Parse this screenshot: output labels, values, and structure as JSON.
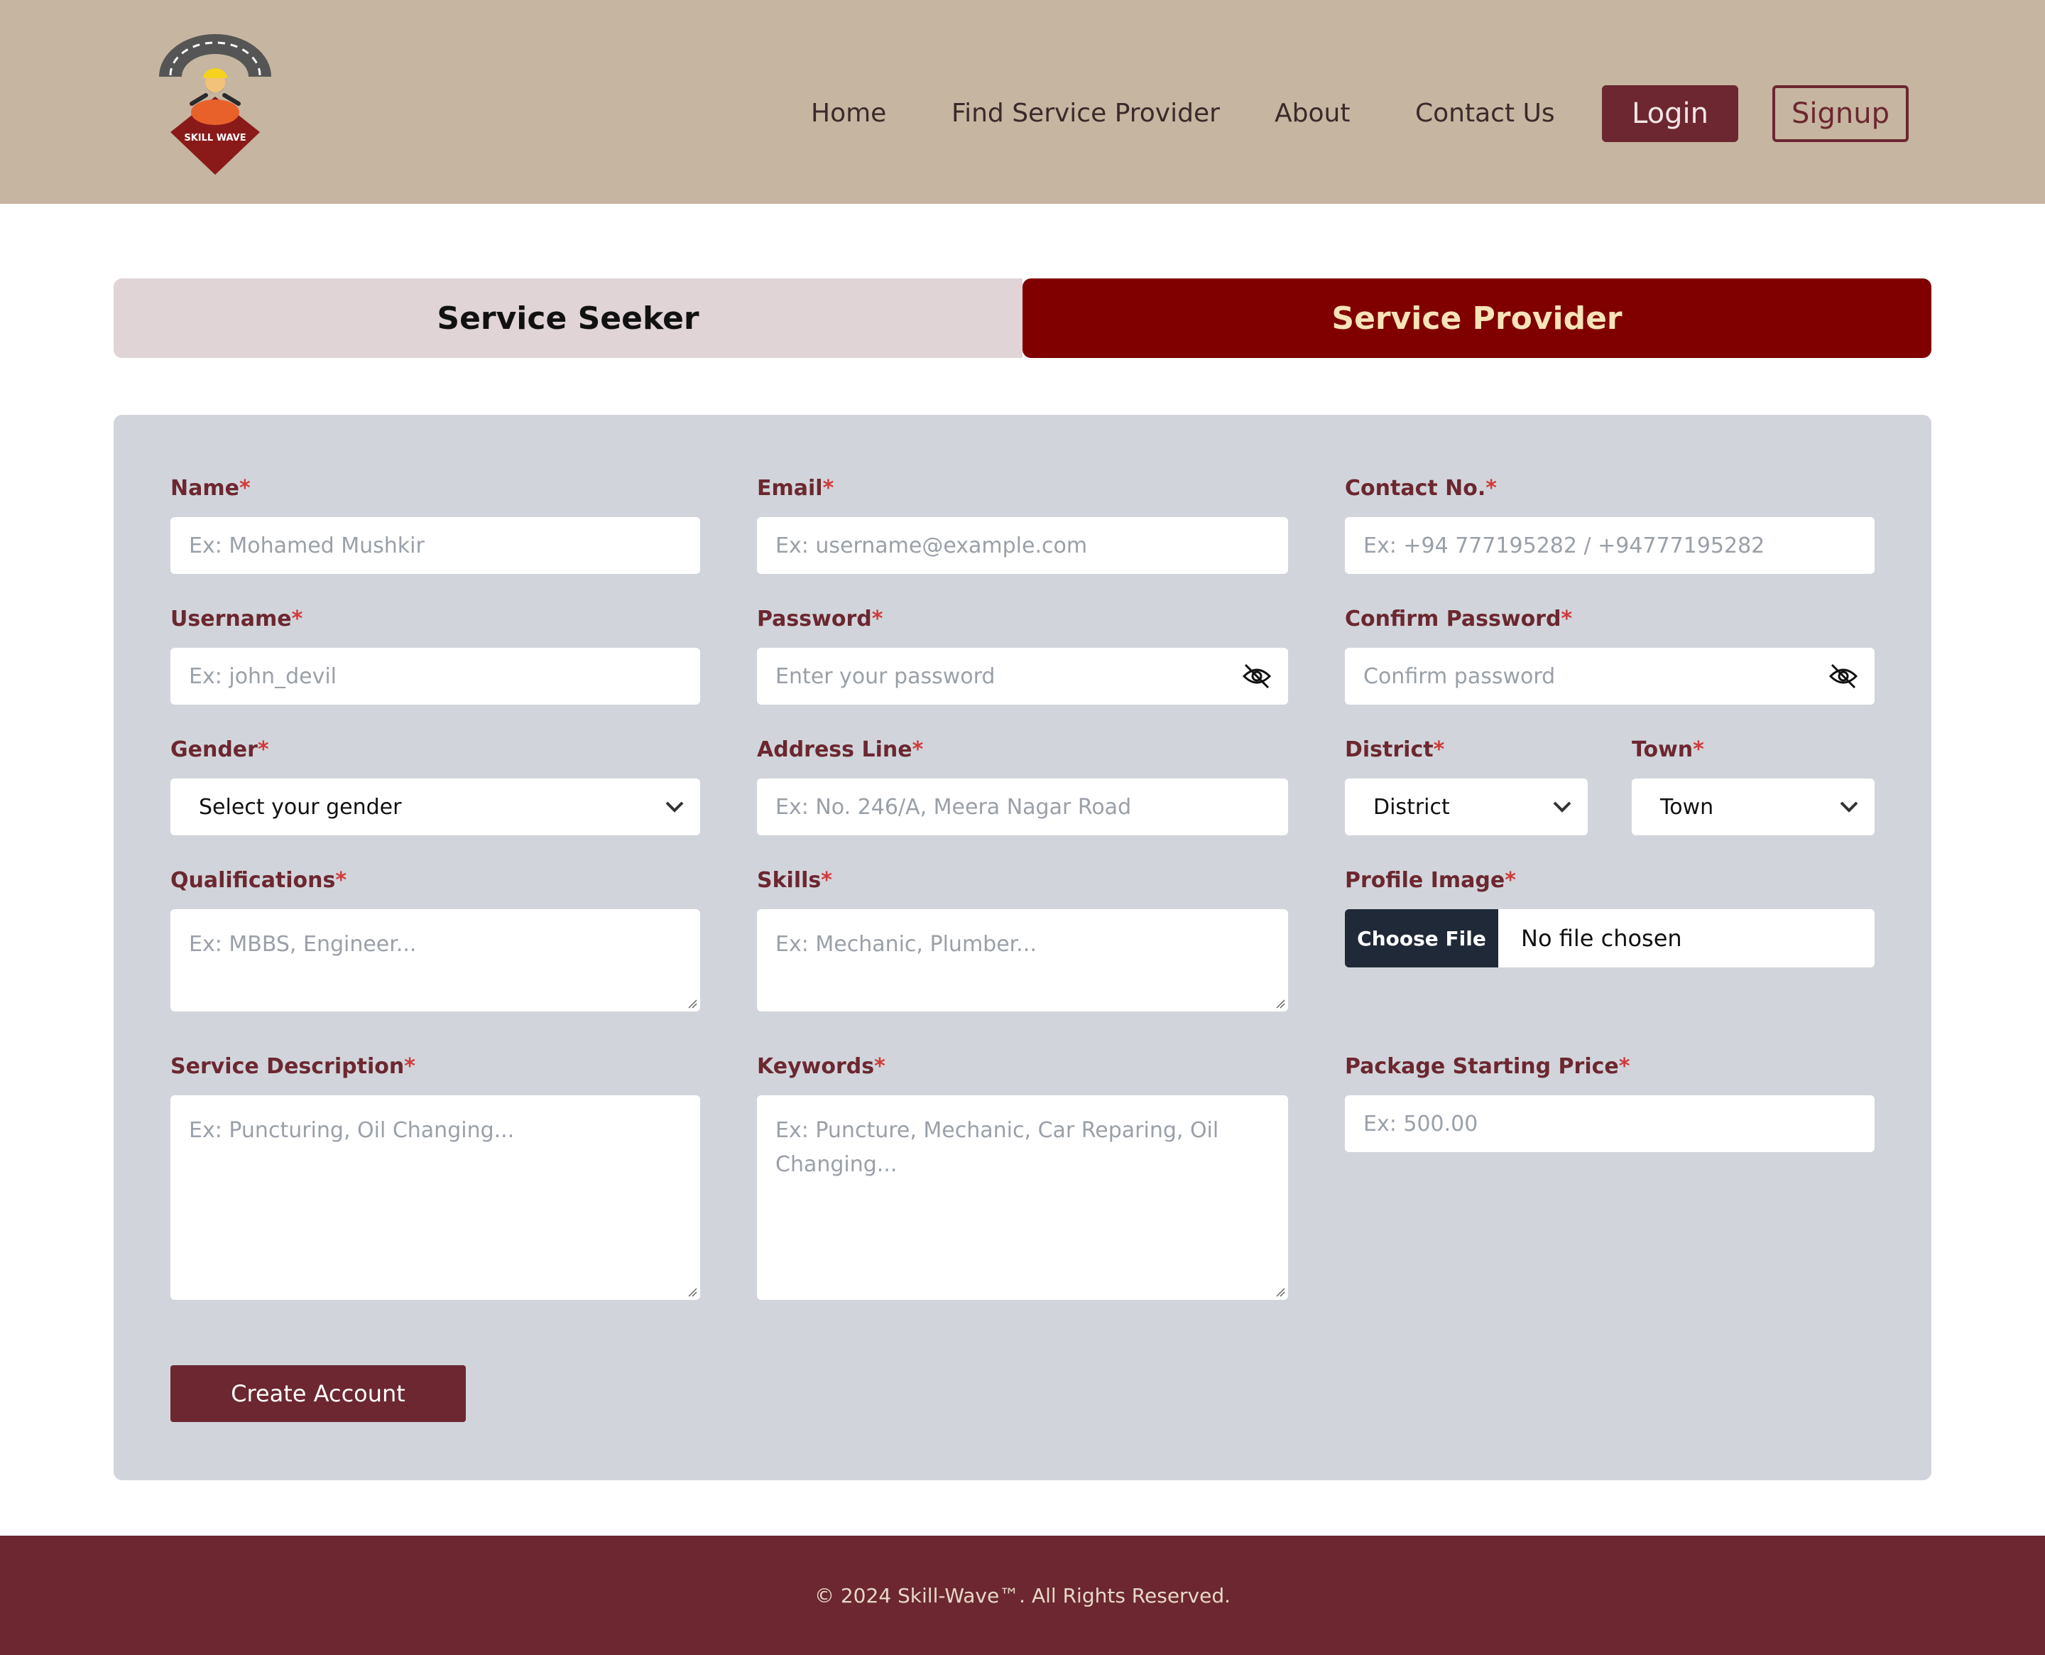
{
  "header": {
    "logo_text": "SKILL WAVE",
    "nav": [
      "Home",
      "Find Service Provider",
      "About",
      "Contact Us"
    ],
    "login_label": "Login",
    "signup_label": "Signup"
  },
  "tabs": {
    "seeker": "Service Seeker",
    "provider": "Service Provider",
    "active": "Service Provider"
  },
  "form": {
    "name": {
      "label": "Name",
      "placeholder": "Ex: Mohamed Mushkir"
    },
    "email": {
      "label": "Email",
      "placeholder": "Ex: username@example.com"
    },
    "contact": {
      "label": "Contact No.",
      "placeholder": "Ex: +94 777195282 / +94777195282"
    },
    "username": {
      "label": "Username",
      "placeholder": "Ex: john_devil"
    },
    "password": {
      "label": "Password",
      "placeholder": "Enter your password"
    },
    "confirm_password": {
      "label": "Confirm Password",
      "placeholder": "Confirm password"
    },
    "gender": {
      "label": "Gender",
      "value": "Select your gender"
    },
    "address": {
      "label": "Address Line",
      "placeholder": "Ex: No. 246/A, Meera Nagar Road"
    },
    "district": {
      "label": "District",
      "value": "District"
    },
    "town": {
      "label": "Town",
      "value": "Town"
    },
    "qualifications": {
      "label": "Qualifications",
      "placeholder": "Ex: MBBS, Engineer..."
    },
    "skills": {
      "label": "Skills",
      "placeholder": "Ex: Mechanic, Plumber..."
    },
    "profile_image": {
      "label": "Profile Image",
      "button": "Choose File",
      "status": "No file chosen"
    },
    "service_description": {
      "label": "Service Description",
      "placeholder": "Ex: Puncturing, Oil Changing..."
    },
    "keywords": {
      "label": "Keywords",
      "placeholder": "Ex: Puncture, Mechanic, Car Reparing, Oil Changing..."
    },
    "package_price": {
      "label": "Package Starting Price",
      "placeholder": "Ex: 500.00"
    },
    "required_mark": "*",
    "submit_label": "Create Account"
  },
  "footer": {
    "text": "© 2024 Skill-Wave™. All Rights Reserved."
  },
  "colors": {
    "header_bg": "#c6b5a0",
    "accent": "#6c2730",
    "provider_tab": "#800000",
    "panel_bg": "#d1d5db"
  }
}
